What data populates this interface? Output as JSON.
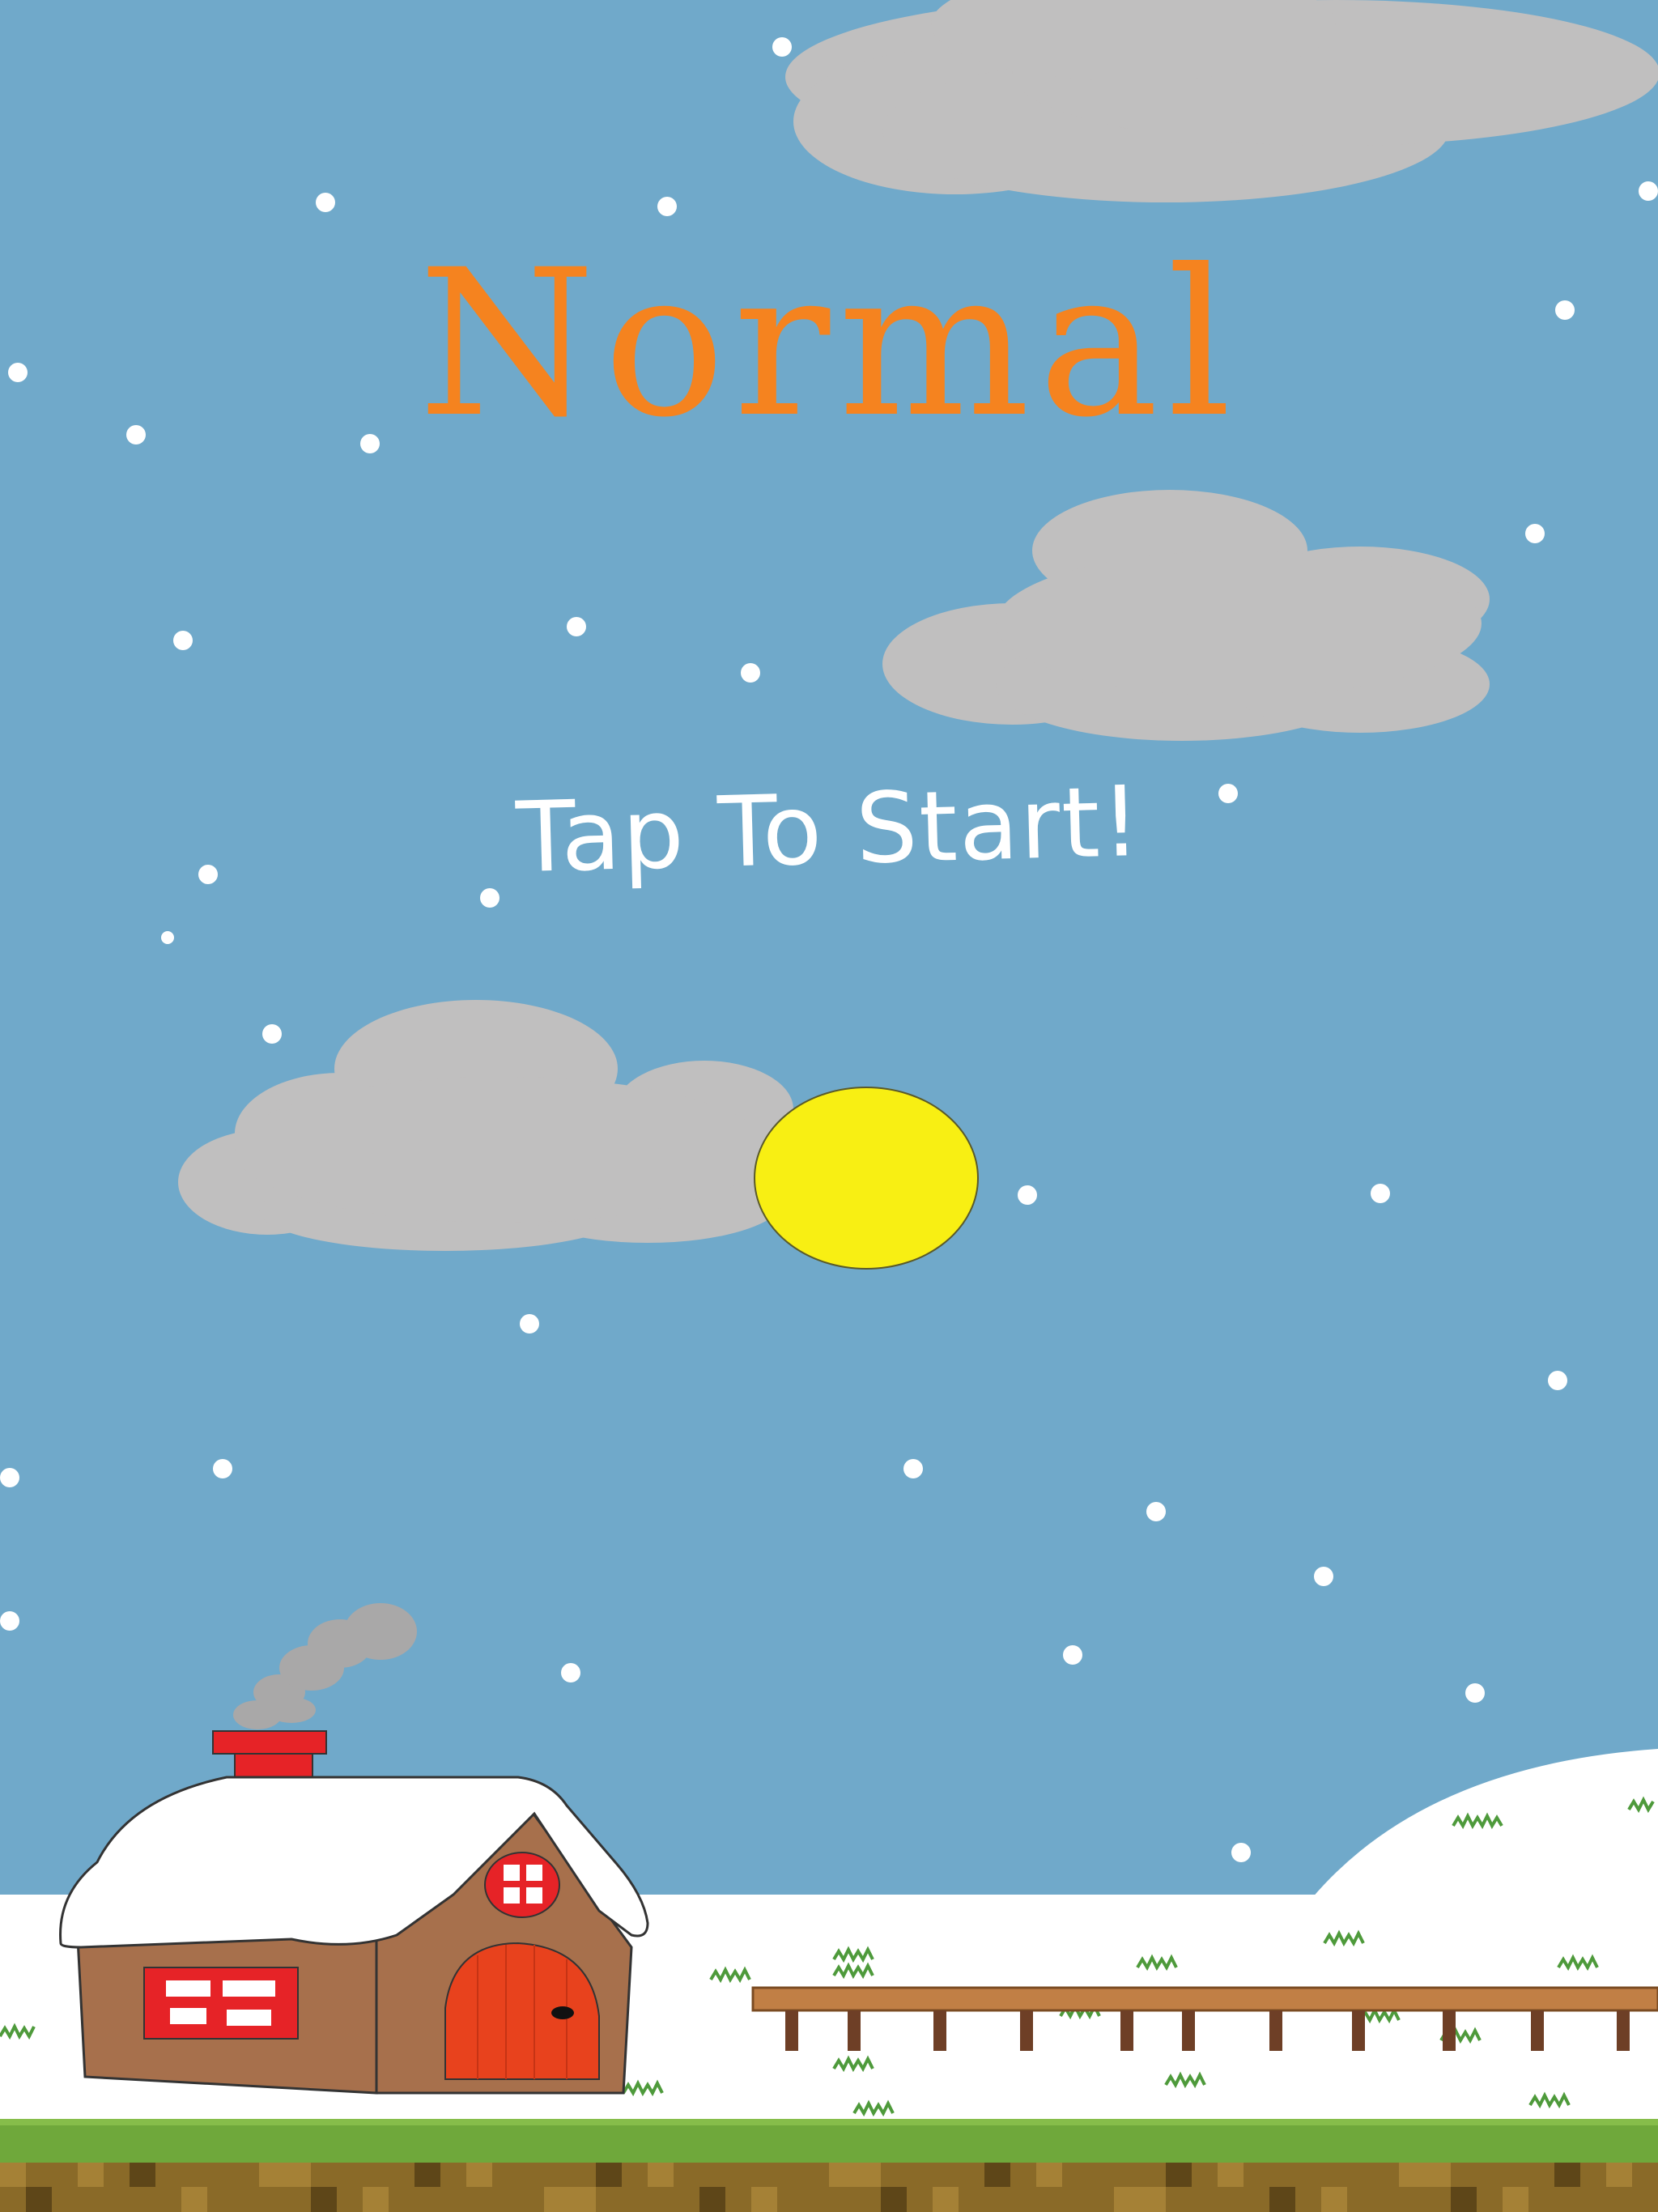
{
  "game": {
    "difficulty_label": "Normal",
    "start_prompt": "Tap To Start!"
  },
  "colors": {
    "sky": "#70a9ca",
    "cloud": "#c0bfbf",
    "sun": "#f8ef13",
    "title": "#f5831f",
    "snow": "#ffffff",
    "house_wall": "#a7704c",
    "door": "#e8421d",
    "window_red": "#e62327",
    "chimney": "#e62327",
    "grass": "#6fa83b",
    "dirt": "#8a6a28",
    "fence": "#a7704c"
  }
}
